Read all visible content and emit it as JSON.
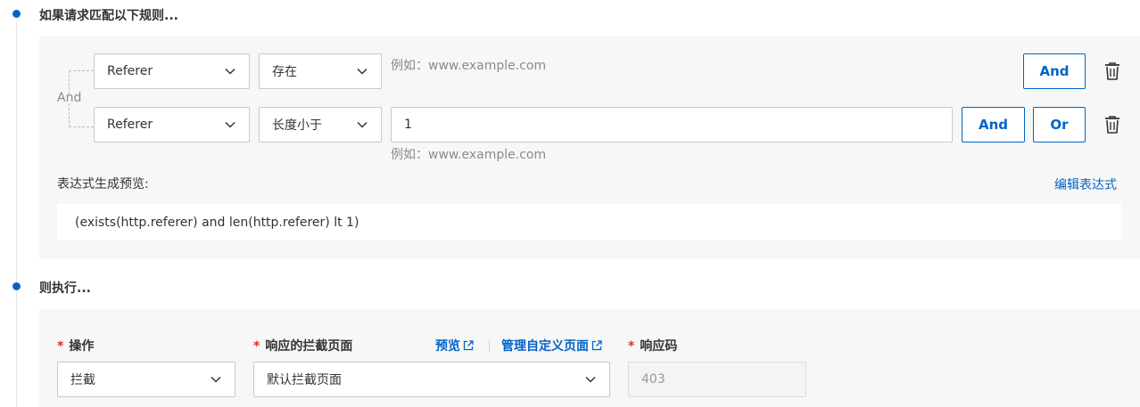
{
  "steps": {
    "if_title": "如果请求匹配以下规则...",
    "then_title": "则执行..."
  },
  "conditions": {
    "group_operator": "And",
    "rows": [
      {
        "field": "Referer",
        "operator": "存在",
        "value_placeholder": "例如：www.example.com",
        "buttons": [
          "And"
        ]
      },
      {
        "field": "Referer",
        "operator": "长度小于",
        "value": "1",
        "value_hint": "例如：www.example.com",
        "buttons": [
          "And",
          "Or"
        ]
      }
    ]
  },
  "expression": {
    "label": "表达式生成预览:",
    "edit_link": "编辑表达式",
    "text": "(exists(http.referer) and len(http.referer) lt 1)"
  },
  "action": {
    "operation": {
      "label": "操作",
      "required_mark": "*",
      "value": "拦截"
    },
    "block_page": {
      "label": "响应的拦截页面",
      "required_mark": "*",
      "value": "默认拦截页面",
      "preview_link": "预览",
      "manage_link": "管理自定义页面"
    },
    "response_code": {
      "label": "响应码",
      "required_mark": "*",
      "value": "403"
    }
  },
  "colors": {
    "accent": "#0064c8",
    "required": "#d93026",
    "panel_bg": "#f7f7f7"
  },
  "icons": {
    "chevron": "chevron-down-icon",
    "trash": "trash-icon",
    "external": "external-link-icon"
  }
}
